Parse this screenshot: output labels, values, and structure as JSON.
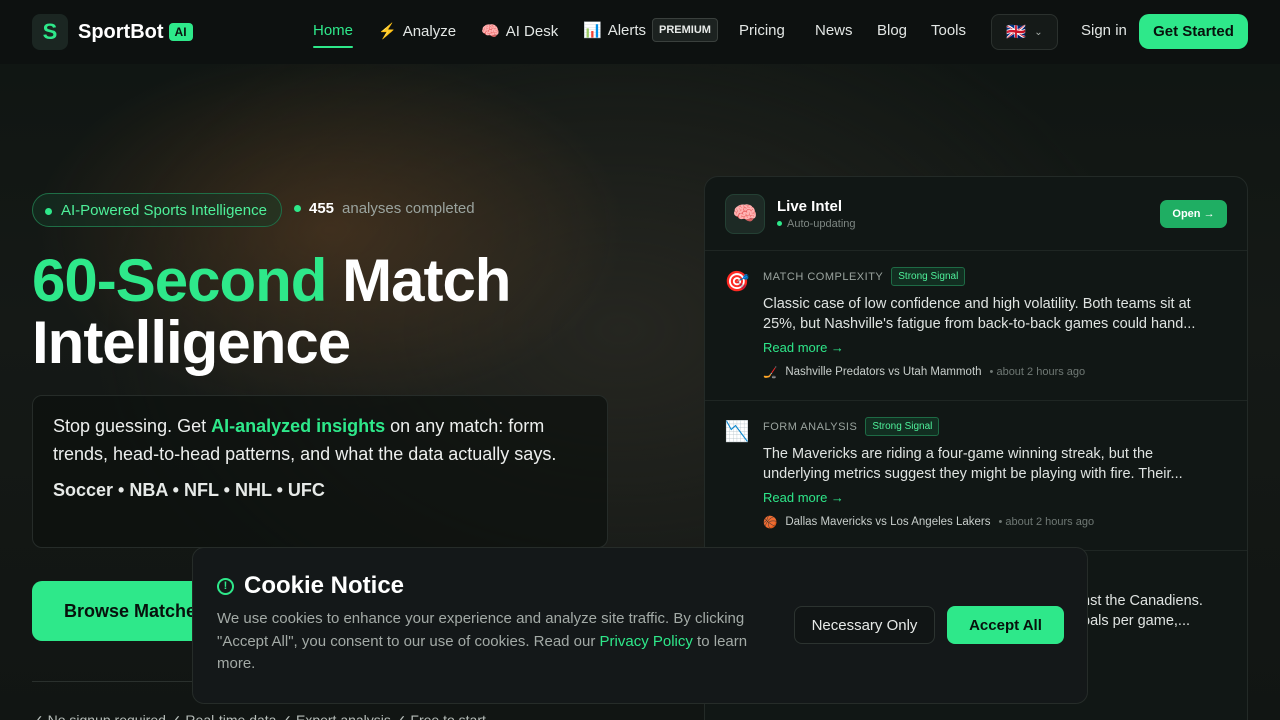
{
  "brand": {
    "name": "SportBot",
    "badge": "AI",
    "mark": "S"
  },
  "nav": {
    "items": [
      {
        "label": "Home",
        "icon": ""
      },
      {
        "label": "Analyze",
        "icon": "⚡"
      },
      {
        "label": "AI Desk",
        "icon": "🧠"
      },
      {
        "label": "Alerts",
        "icon": "📊",
        "badge": "PREMIUM"
      },
      {
        "label": "Pricing"
      },
      {
        "label": "News"
      },
      {
        "label": "Blog"
      },
      {
        "label": "Tools"
      }
    ],
    "language_flag": "🇬🇧",
    "sign_in": "Sign in",
    "get_started": "Get Started"
  },
  "hero": {
    "pill": "AI-Powered Sports Intelligence",
    "stats_count": "455",
    "stats_label": "analyses completed",
    "title_highlight": "60-Second",
    "title_rest_line1": "Match",
    "title_line2": "Intelligence",
    "desc_pre": "Stop guessing. Get ",
    "desc_highlight": "AI-analyzed insights",
    "desc_post": " on any match: form trends, head-to-head patterns, and what the data actually says.",
    "sports": "Soccer • NBA • NFL • NHL • UFC",
    "browse_button": "Browse Matches",
    "features": "✓ No signup required   ✓ Real-time data   ✓ Expert analysis   ✓ Free to start"
  },
  "intel": {
    "title": "Live Intel",
    "subtitle": "Auto-updating",
    "open_button": "Open →",
    "items": [
      {
        "icon": "🎯",
        "category": "MATCH COMPLEXITY",
        "signal": "Strong Signal",
        "text": "Classic case of low confidence and high volatility. Both teams sit at 25%, but Nashville's fatigue from back-to-back games could hand...",
        "read_more": "Read more →",
        "sport_icon": "🏒",
        "match": "Nashville Predators vs Utah Mammoth",
        "time": "• about 2 hours ago"
      },
      {
        "icon": "📉",
        "category": "FORM ANALYSIS",
        "signal": "Strong Signal",
        "text": "The Mavericks are riding a four-game winning streak, but the underlying metrics suggest they might be playing with fire. Their...",
        "read_more": "Read more →",
        "sport_icon": "🏀",
        "match": "Dallas Mavericks vs Los Angeles Lakers",
        "time": "• about 2 hours ago"
      }
    ],
    "peek_line1": "nst the Canadiens.",
    "peek_line2": "oals per game,..."
  },
  "cookie": {
    "title": "Cookie Notice",
    "text_pre": "We use cookies to enhance your experience and analyze site traffic. By clicking \"Accept All\", you consent to our use of cookies. Read our ",
    "link": "Privacy Policy",
    "text_post": " to learn more.",
    "necessary_button": "Necessary Only",
    "accept_button": "Accept All"
  }
}
